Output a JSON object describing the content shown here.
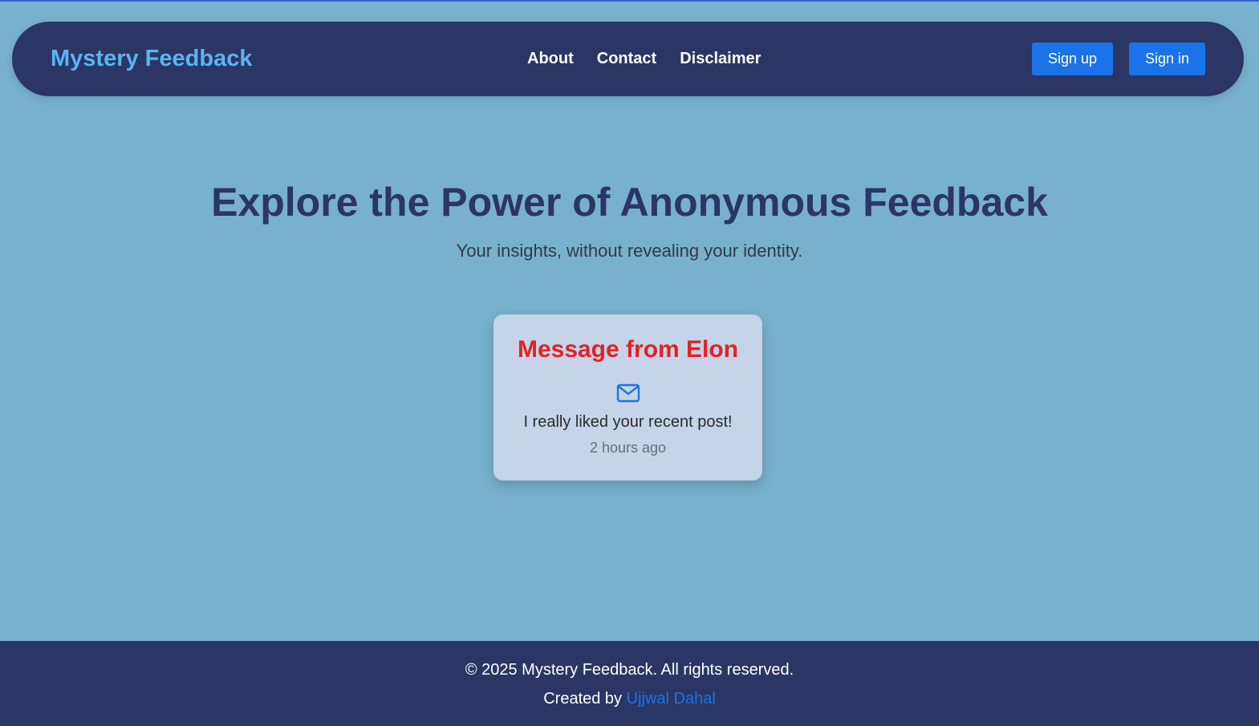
{
  "navbar": {
    "brand": "Mystery Feedback",
    "links": [
      "About",
      "Contact",
      "Disclaimer"
    ],
    "signup_label": "Sign up",
    "signin_label": "Sign in"
  },
  "hero": {
    "title": "Explore the Power of Anonymous Feedback",
    "subtitle": "Your insights, without revealing your identity."
  },
  "message_card": {
    "title": "Message from Elon",
    "icon": "mail-icon",
    "content": "I really liked your recent post!",
    "time": "2 hours ago"
  },
  "footer": {
    "copyright": "© 2025 Mystery Feedback. All rights reserved.",
    "created_by_prefix": "Created by",
    "author": "Ujjwal Dahal"
  },
  "colors": {
    "page_background": "#78b1cc",
    "navbar_background": "#2b3664",
    "brand": "#5ab4f5",
    "button": "#1a73e8",
    "heading": "#2b3664",
    "card_title": "#e02323",
    "card_background": "#c5d4e8",
    "link": "#1a73e8"
  }
}
